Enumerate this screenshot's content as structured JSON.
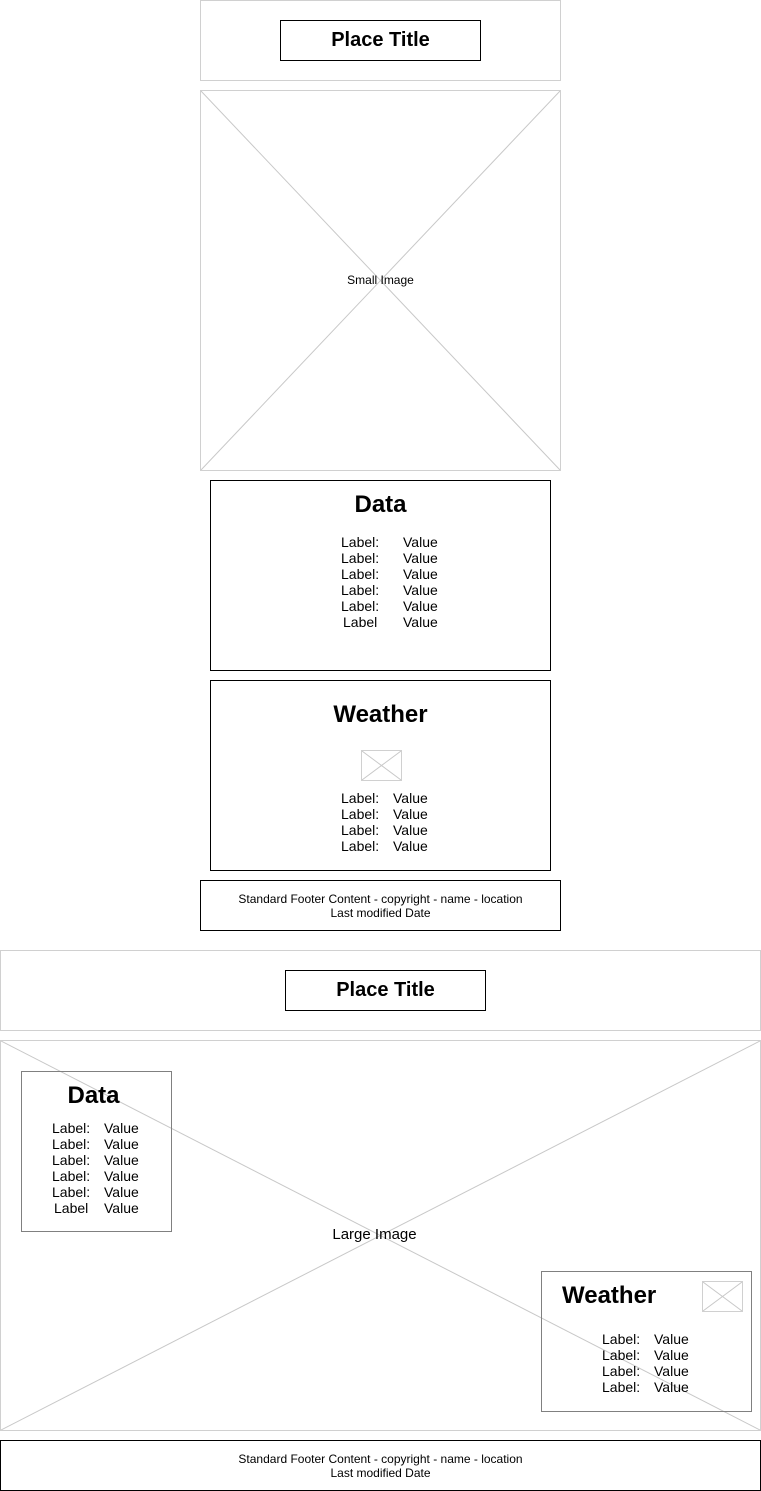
{
  "small_layout": {
    "title": "Place Title",
    "image_label": "Small Image",
    "data_panel": {
      "title": "Data",
      "rows": [
        {
          "label": "Label:",
          "value": "Value"
        },
        {
          "label": "Label:",
          "value": "Value"
        },
        {
          "label": "Label:",
          "value": "Value"
        },
        {
          "label": "Label:",
          "value": "Value"
        },
        {
          "label": "Label:",
          "value": "Value"
        },
        {
          "label": "Label",
          "value": "Value"
        }
      ]
    },
    "weather_panel": {
      "title": "Weather",
      "icon": "weather-image-placeholder",
      "rows": [
        {
          "label": "Label:",
          "value": "Value"
        },
        {
          "label": "Label:",
          "value": "Value"
        },
        {
          "label": "Label:",
          "value": "Value"
        },
        {
          "label": "Label:",
          "value": "Value"
        }
      ]
    },
    "footer": {
      "line1": "Standard Footer Content - copyright - name - location",
      "line2": "Last modified Date"
    }
  },
  "large_layout": {
    "title": "Place Title",
    "image_label": "Large Image",
    "data_panel": {
      "title": "Data",
      "rows": [
        {
          "label": "Label:",
          "value": "Value"
        },
        {
          "label": "Label:",
          "value": "Value"
        },
        {
          "label": "Label:",
          "value": "Value"
        },
        {
          "label": "Label:",
          "value": "Value"
        },
        {
          "label": "Label:",
          "value": "Value"
        },
        {
          "label": "Label",
          "value": "Value"
        }
      ]
    },
    "weather_panel": {
      "title": "Weather",
      "icon": "weather-image-placeholder",
      "rows": [
        {
          "label": "Label:",
          "value": "Value"
        },
        {
          "label": "Label:",
          "value": "Value"
        },
        {
          "label": "Label:",
          "value": "Value"
        },
        {
          "label": "Label:",
          "value": "Value"
        }
      ]
    },
    "footer": {
      "line1": "Standard Footer Content - copyright - name - location",
      "line2": "Last modified Date"
    }
  }
}
